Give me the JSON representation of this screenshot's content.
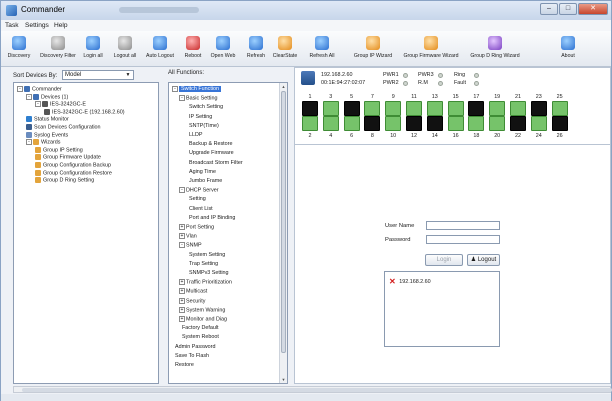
{
  "window": {
    "title": "Commander"
  },
  "menu": [
    "Task",
    "Settings",
    "Help"
  ],
  "toolbar": [
    {
      "label": "Discovery",
      "icon": "magnifier-icon",
      "cls": "ico-blue"
    },
    {
      "label": "Discovery Filter",
      "icon": "magnifier-filter-icon",
      "cls": "ico-gray"
    },
    {
      "label": "Login all",
      "icon": "user-icon",
      "cls": "ico-blue"
    },
    {
      "label": "Logout all",
      "icon": "user-logout-icon",
      "cls": "ico-gray"
    },
    {
      "label": "Auto Logout",
      "icon": "user-auto-icon",
      "cls": "ico-blue"
    },
    {
      "label": "Reboot",
      "icon": "reboot-icon",
      "cls": "ico-red"
    },
    {
      "label": "Open Web",
      "icon": "globe-icon",
      "cls": "ico-blue"
    },
    {
      "label": "Refresh",
      "icon": "refresh-icon",
      "cls": "ico-blue"
    },
    {
      "label": "ClearState",
      "icon": "broom-icon",
      "cls": "ico-orange"
    },
    {
      "label": "Refresh All",
      "icon": "refresh-all-icon",
      "cls": "ico-blue"
    },
    {
      "label": "Group IP Wizard",
      "icon": "wand-icon",
      "cls": "ico-orange"
    },
    {
      "label": "Group Firmware Wizard",
      "icon": "wand-icon",
      "cls": "ico-orange"
    },
    {
      "label": "Group D Ring Wizard",
      "icon": "wand-icon",
      "cls": "ico-purple"
    },
    {
      "label": "About",
      "icon": "info-icon",
      "cls": "ico-blue"
    }
  ],
  "filter": {
    "label": "Sort Devices By:",
    "value": "Model"
  },
  "left_tree": [
    {
      "label": "Commander",
      "box": "-",
      "ico": "ti-pc",
      "indent": 0
    },
    {
      "label": "Devices (1)",
      "box": "-",
      "ico": "ti-pc",
      "indent": 1
    },
    {
      "label": "IES-3242GC-E",
      "box": "-",
      "ico": "ti-sw",
      "indent": 2
    },
    {
      "label": "IES-3242GC-E (192.168.2.60)",
      "box": "",
      "ico": "ti-sw",
      "indent": 3
    },
    {
      "label": "Status Monitor",
      "box": "",
      "ico": "ti-mon",
      "indent": 1
    },
    {
      "label": "Scan Devices Configuration",
      "box": "",
      "ico": "ti-scan",
      "indent": 1
    },
    {
      "label": "Syslog Events",
      "box": "",
      "ico": "ti-sys",
      "indent": 1
    },
    {
      "label": "Wizards",
      "box": "-",
      "ico": "ti-wiz",
      "indent": 1
    },
    {
      "label": "Group IP Setting",
      "box": "",
      "ico": "ti-wiz",
      "indent": 2
    },
    {
      "label": "Group Firmware Update",
      "box": "",
      "ico": "ti-wiz",
      "indent": 2
    },
    {
      "label": "Group Configuration Backup",
      "box": "",
      "ico": "ti-wiz",
      "indent": 2
    },
    {
      "label": "Group Configuration Restore",
      "box": "",
      "ico": "ti-wiz",
      "indent": 2
    },
    {
      "label": "Group D Ring Setting",
      "box": "",
      "ico": "ti-wiz",
      "indent": 2
    }
  ],
  "functions": {
    "label": "All Functions:",
    "items": [
      {
        "label": "Switch Function",
        "box": "-",
        "indent": 0,
        "selected": true
      },
      {
        "label": "Basic Setting",
        "box": "-",
        "indent": 1
      },
      {
        "label": "Switch Setting",
        "box": "",
        "indent": 2
      },
      {
        "label": "IP Setting",
        "box": "",
        "indent": 2
      },
      {
        "label": "SNTP(Time)",
        "box": "",
        "indent": 2
      },
      {
        "label": "LLDP",
        "box": "",
        "indent": 2
      },
      {
        "label": "Backup & Restore",
        "box": "",
        "indent": 2
      },
      {
        "label": "Upgrade Firmware",
        "box": "",
        "indent": 2
      },
      {
        "label": "Broadcast Storm Filter",
        "box": "",
        "indent": 2
      },
      {
        "label": "Aging Time",
        "box": "",
        "indent": 2
      },
      {
        "label": "Jumbo Frame",
        "box": "",
        "indent": 2
      },
      {
        "label": "DHCP Server",
        "box": "-",
        "indent": 1
      },
      {
        "label": "Setting",
        "box": "",
        "indent": 2
      },
      {
        "label": "Client List",
        "box": "",
        "indent": 2
      },
      {
        "label": "Port and IP Binding",
        "box": "",
        "indent": 2
      },
      {
        "label": "Port Setting",
        "box": "+",
        "indent": 1
      },
      {
        "label": "Vlan",
        "box": "+",
        "indent": 1
      },
      {
        "label": "SNMP",
        "box": "-",
        "indent": 1
      },
      {
        "label": "System Setting",
        "box": "",
        "indent": 2
      },
      {
        "label": "Trap Setting",
        "box": "",
        "indent": 2
      },
      {
        "label": "SNMPv3 Setting",
        "box": "",
        "indent": 2
      },
      {
        "label": "Traffic Prioritization",
        "box": "+",
        "indent": 1
      },
      {
        "label": "Multicast",
        "box": "+",
        "indent": 1
      },
      {
        "label": "Security",
        "box": "+",
        "indent": 1
      },
      {
        "label": "System Warning",
        "box": "+",
        "indent": 1
      },
      {
        "label": "Monitor and Diag",
        "box": "+",
        "indent": 1
      },
      {
        "label": "Factory Default",
        "box": "",
        "indent": 1
      },
      {
        "label": "System Reboot",
        "box": "",
        "indent": 1
      },
      {
        "label": "Admin Password",
        "box": "",
        "indent": 0
      },
      {
        "label": "Save To Flash",
        "box": "",
        "indent": 0
      },
      {
        "label": "Restore",
        "box": "",
        "indent": 0
      }
    ]
  },
  "device": {
    "ip": "192.168.2.60",
    "mac": "00:1E:94:27:02:07",
    "leds": [
      {
        "label": "PWR1"
      },
      {
        "label": "PWR3"
      },
      {
        "label": "Ring"
      },
      {
        "label": "PWR2"
      },
      {
        "label": "R.M"
      },
      {
        "label": "Fault"
      }
    ],
    "ports_top": [
      {
        "num": "1",
        "up": false
      },
      {
        "num": "3",
        "up": true
      },
      {
        "num": "5",
        "up": false
      },
      {
        "num": "7",
        "up": true
      },
      {
        "num": "9",
        "up": true
      },
      {
        "num": "11",
        "up": true
      },
      {
        "num": "13",
        "up": true
      },
      {
        "num": "15",
        "up": true
      },
      {
        "num": "17",
        "up": false
      },
      {
        "num": "19",
        "up": true
      },
      {
        "num": "21",
        "up": true
      },
      {
        "num": "23",
        "up": false
      },
      {
        "num": "25",
        "up": true
      }
    ],
    "ports_bottom": [
      {
        "num": "2",
        "up": true
      },
      {
        "num": "4",
        "up": true
      },
      {
        "num": "6",
        "up": true
      },
      {
        "num": "8",
        "up": false
      },
      {
        "num": "10",
        "up": true
      },
      {
        "num": "12",
        "up": false
      },
      {
        "num": "14",
        "up": false
      },
      {
        "num": "16",
        "up": true
      },
      {
        "num": "18",
        "up": true
      },
      {
        "num": "20",
        "up": true
      },
      {
        "num": "22",
        "up": false
      },
      {
        "num": "24",
        "up": true
      },
      {
        "num": "26",
        "up": false
      }
    ]
  },
  "login": {
    "user_label": "User Name",
    "password_label": "Password",
    "login_btn": "Login",
    "logout_btn": "Logout"
  },
  "results": [
    {
      "ip": "192.168.2.60",
      "status": "error"
    }
  ]
}
